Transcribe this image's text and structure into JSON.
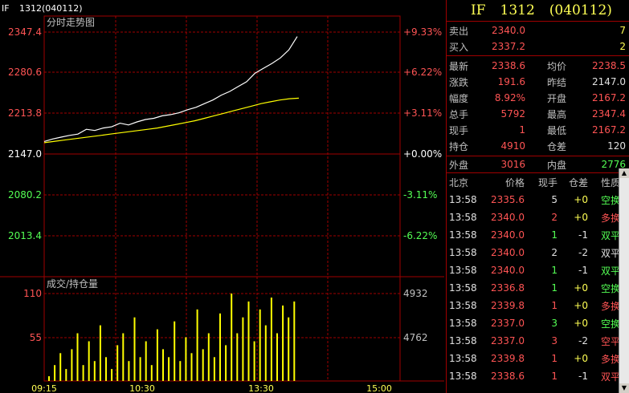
{
  "header": {
    "symbol": "IF",
    "code": "1312",
    "id": "(040112)"
  },
  "chart": {
    "title": "分时走势图",
    "volume_title": "成交/持仓量",
    "price_labels": [
      "2347.4",
      "2280.6",
      "2213.8",
      "2147.0",
      "2080.2",
      "2013.4"
    ],
    "pct_labels": [
      "+9.33%",
      "+6.22%",
      "+3.11%",
      "+0.00%",
      "-3.11%",
      "-6.22%"
    ],
    "vol_left": [
      "110",
      "55"
    ],
    "vol_right": [
      "4932",
      "4762"
    ],
    "time_labels": [
      "09:15",
      "10:30",
      "13:30",
      "15:00"
    ],
    "colors": {
      "up": "#ff5454",
      "down": "#54ff54",
      "flat": "#ffffff",
      "grid": "#a00000",
      "price": "#ffffff",
      "avg": "#ffff00"
    }
  },
  "chart_data": [
    {
      "type": "line",
      "series": [
        {
          "values": [
            2168,
            2172,
            2175,
            2178,
            2180,
            2188,
            2186,
            2190,
            2192,
            2198,
            2195,
            2200,
            2204,
            2206,
            2210,
            2212,
            2215,
            2220,
            2224,
            2230,
            2236,
            2244,
            2250,
            2258,
            2266,
            2280,
            2288,
            2296,
            2305,
            2318,
            2340
          ]
        },
        {
          "values": [
            2166,
            2168,
            2170,
            2172,
            2174,
            2176,
            2178,
            2180,
            2182,
            2184,
            2186,
            2188,
            2190,
            2193,
            2196,
            2199,
            2202,
            2206,
            2210,
            2214,
            2218,
            2222,
            2226,
            2230,
            2233,
            2236,
            2238,
            2239
          ]
        }
      ],
      "ylim": [
        1979,
        2347.4
      ]
    },
    {
      "type": "bar",
      "values": [
        6,
        20,
        35,
        15,
        40,
        60,
        20,
        50,
        25,
        70,
        30,
        15,
        45,
        60,
        25,
        80,
        30,
        50,
        20,
        65,
        40,
        30,
        75,
        25,
        55,
        35,
        90,
        40,
        60,
        30,
        85,
        45,
        110,
        60,
        80,
        100,
        50,
        90,
        70,
        105,
        60,
        95,
        80,
        100
      ],
      "ylim": [
        0,
        110
      ]
    }
  ],
  "panel": {
    "ask": {
      "label": "卖出",
      "price": "2340.0",
      "vol": "7"
    },
    "bid": {
      "label": "买入",
      "price": "2337.2",
      "vol": "2"
    },
    "stats": [
      {
        "l1": "最新",
        "v1": "2338.6",
        "c1": "red",
        "l2": "均价",
        "v2": "2238.5",
        "c2": "red"
      },
      {
        "l1": "涨跌",
        "v1": "191.6",
        "c1": "red",
        "l2": "昨结",
        "v2": "2147.0",
        "c2": "white"
      },
      {
        "l1": "幅度",
        "v1": "8.92%",
        "c1": "red",
        "l2": "开盘",
        "v2": "2167.2",
        "c2": "red"
      },
      {
        "l1": "总手",
        "v1": "5792",
        "c1": "yellow",
        "l2": "最高",
        "v2": "2347.4",
        "c2": "red"
      },
      {
        "l1": "现手",
        "v1": "1",
        "c1": "yellow",
        "l2": "最低",
        "v2": "2167.2",
        "c2": "red"
      },
      {
        "l1": "持仓",
        "v1": "4910",
        "c1": "yellow",
        "l2": "仓差",
        "v2": "120",
        "c2": "white"
      }
    ],
    "outer": {
      "label": "外盘",
      "value": "3016"
    },
    "inner": {
      "label": "内盘",
      "value": "2776"
    },
    "table_headers": [
      "北京",
      "价格",
      "现手",
      "仓差",
      "性质"
    ],
    "trades": [
      {
        "time": "13:58",
        "price": "2335.6",
        "hand": "5",
        "diff": "+0",
        "type": "空换",
        "pc": "red",
        "hc": "white",
        "tc": "green"
      },
      {
        "time": "13:58",
        "price": "2340.0",
        "hand": "2",
        "diff": "+0",
        "type": "多换",
        "pc": "red",
        "hc": "red",
        "tc": "red"
      },
      {
        "time": "13:58",
        "price": "2340.0",
        "hand": "1",
        "diff": "-1",
        "type": "双平",
        "pc": "red",
        "hc": "green",
        "tc": "green"
      },
      {
        "time": "13:58",
        "price": "2340.0",
        "hand": "2",
        "diff": "-2",
        "type": "双平",
        "pc": "red",
        "hc": "white",
        "tc": "white"
      },
      {
        "time": "13:58",
        "price": "2340.0",
        "hand": "1",
        "diff": "-1",
        "type": "双平",
        "pc": "red",
        "hc": "green",
        "tc": "green"
      },
      {
        "time": "13:58",
        "price": "2336.8",
        "hand": "1",
        "diff": "+0",
        "type": "空换",
        "pc": "red",
        "hc": "green",
        "tc": "green"
      },
      {
        "time": "13:58",
        "price": "2339.8",
        "hand": "1",
        "diff": "+0",
        "type": "多换",
        "pc": "red",
        "hc": "red",
        "tc": "red"
      },
      {
        "time": "13:58",
        "price": "2337.0",
        "hand": "3",
        "diff": "+0",
        "type": "空换",
        "pc": "red",
        "hc": "green",
        "tc": "green"
      },
      {
        "time": "13:58",
        "price": "2337.0",
        "hand": "3",
        "diff": "-2",
        "type": "空平",
        "pc": "red",
        "hc": "red",
        "tc": "red"
      },
      {
        "time": "13:58",
        "price": "2339.8",
        "hand": "1",
        "diff": "+0",
        "type": "多换",
        "pc": "red",
        "hc": "red",
        "tc": "red"
      },
      {
        "time": "13:58",
        "price": "2338.6",
        "hand": "1",
        "diff": "-1",
        "type": "双平",
        "pc": "red",
        "hc": "red",
        "tc": "red"
      }
    ]
  }
}
